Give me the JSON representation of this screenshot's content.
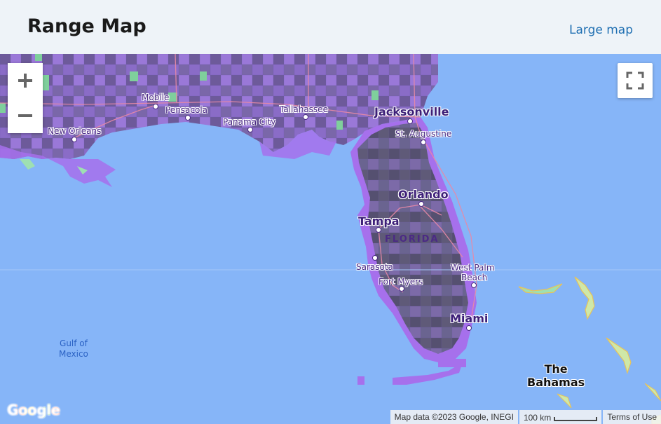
{
  "header": {
    "title": "Range Map",
    "large_map_link": "Large map"
  },
  "map": {
    "zoom_in_icon": "plus-icon",
    "zoom_out_icon": "minus-icon",
    "fullscreen_icon": "fullscreen-icon",
    "water_color": "#86b5f8",
    "land_color": "#9b7fd6",
    "range_color": "#a670ec",
    "places": {
      "mobile": "Mobile",
      "pensacola": "Pensacola",
      "tallahassee": "Tallahassee",
      "new_orleans": "New Orleans",
      "panama_city": "Panama City",
      "jacksonville": "Jacksonville",
      "st_augustine": "St. Augustine",
      "orlando": "Orlando",
      "tampa": "Tampa",
      "florida": "FLORIDA",
      "sarasota": "Sarasota",
      "west_palm": "West Palm",
      "beach": "Beach",
      "fort_myers": "Fort Myers",
      "miami": "Miami",
      "gulf_of": "Gulf of",
      "mexico": "Mexico",
      "the": "The",
      "bahamas": "Bahamas"
    },
    "google_logo": "Google",
    "attribution": {
      "map_data": "Map data ©2023 Google, INEGI",
      "scale": "100 km",
      "terms": "Terms of Use"
    }
  }
}
